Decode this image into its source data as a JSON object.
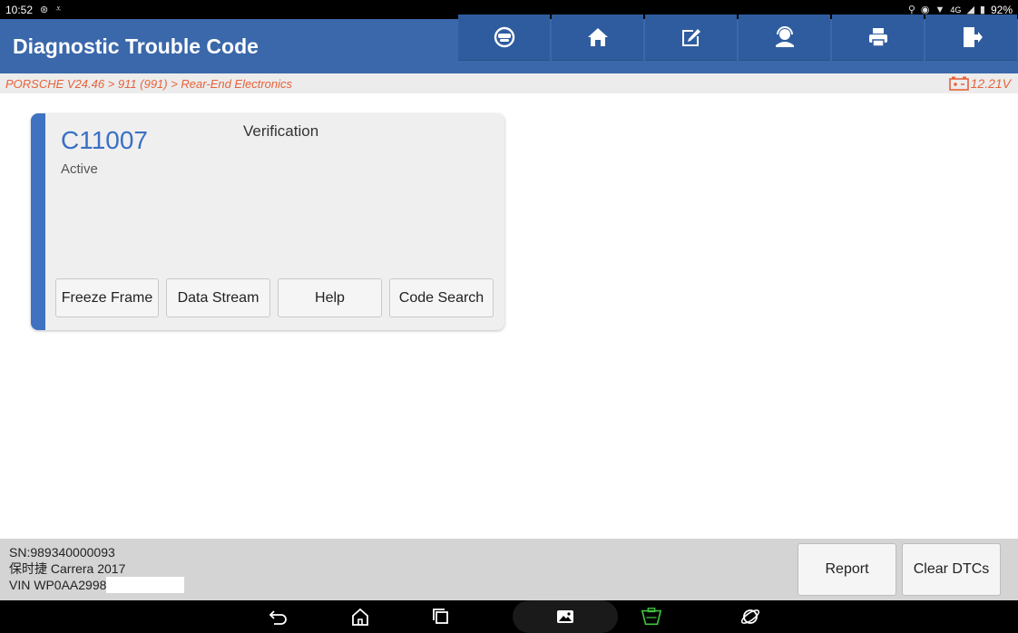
{
  "status_bar": {
    "time": "10:52",
    "battery": "92%",
    "network": "4G"
  },
  "header": {
    "title": "Diagnostic Trouble Code",
    "toolbar": [
      {
        "name": "remote-diagnosis-icon"
      },
      {
        "name": "home-icon"
      },
      {
        "name": "edit-icon"
      },
      {
        "name": "support-icon"
      },
      {
        "name": "print-icon"
      },
      {
        "name": "exit-icon"
      }
    ]
  },
  "breadcrumb": {
    "path": "PORSCHE V24.46 > 911 (991) > Rear-End Electronics",
    "voltage": "12.21V"
  },
  "dtc": {
    "code": "C11007",
    "description": "Verification",
    "status": "Active",
    "buttons": {
      "freeze_frame": "Freeze Frame",
      "data_stream": "Data Stream",
      "help": "Help",
      "code_search": "Code Search"
    }
  },
  "vehicle": {
    "sn": "SN:989340000093",
    "model": "保时捷 Carrera 2017",
    "vin": "VIN WP0AA2998"
  },
  "actions": {
    "report": "Report",
    "clear_dtcs": "Clear DTCs"
  },
  "colors": {
    "header_bg": "#3a68aa",
    "accent": "#3f72c0",
    "breadcrumb_text": "#e8623a"
  }
}
